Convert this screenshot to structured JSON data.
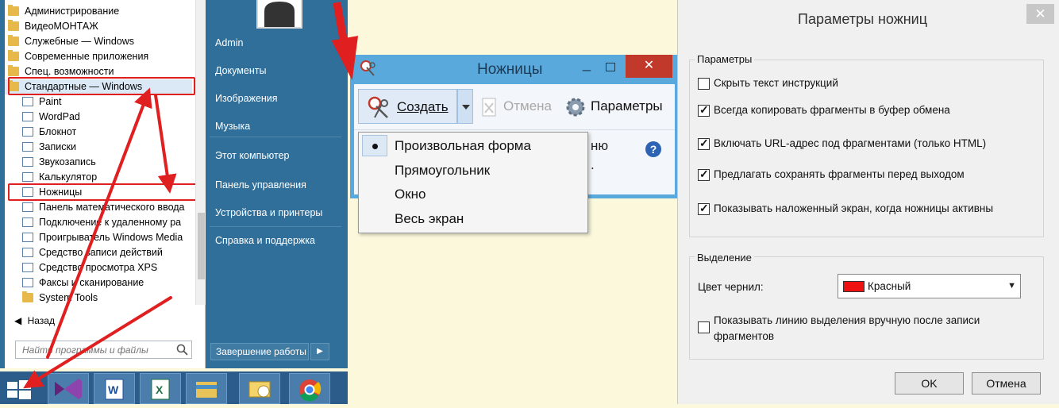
{
  "start_menu": {
    "programs": [
      {
        "label": "Администрирование",
        "icon": "folder-icon"
      },
      {
        "label": "ВидеоМОНТАЖ",
        "icon": "folder-icon"
      },
      {
        "label": "Служебные — Windows",
        "icon": "folder-icon"
      },
      {
        "label": "Современные приложения",
        "icon": "folder-icon"
      },
      {
        "label": "Спец. возможности",
        "icon": "folder-icon"
      },
      {
        "label": "Стандартные — Windows",
        "icon": "folder-icon"
      },
      {
        "label": "Paint",
        "icon": "paint-icon"
      },
      {
        "label": "WordPad",
        "icon": "wordpad-icon"
      },
      {
        "label": "Блокнот",
        "icon": "notepad-icon"
      },
      {
        "label": "Записки",
        "icon": "sticky-notes-icon"
      },
      {
        "label": "Звукозапись",
        "icon": "microphone-icon"
      },
      {
        "label": "Калькулятор",
        "icon": "calculator-icon"
      },
      {
        "label": "Ножницы",
        "icon": "scissors-icon"
      },
      {
        "label": "Панель математического ввода",
        "icon": "math-input-icon"
      },
      {
        "label": "Подключение к удаленному ра",
        "icon": "remote-desktop-icon"
      },
      {
        "label": "Проигрыватель Windows Media",
        "icon": "media-player-icon"
      },
      {
        "label": "Средство записи действий",
        "icon": "steps-recorder-icon"
      },
      {
        "label": "Средство просмотра XPS",
        "icon": "xps-viewer-icon"
      },
      {
        "label": "Факсы и сканирование",
        "icon": "fax-icon"
      },
      {
        "label": "System Tools",
        "icon": "folder-icon"
      }
    ],
    "back_label": "Назад",
    "search_placeholder": "Найти программы и файлы",
    "right_links": [
      "Admin",
      "Документы",
      "Изображения",
      "Музыка",
      "Этот компьютер",
      "Панель управления",
      "Устройства и принтеры",
      "Справка и поддержка"
    ],
    "shutdown_label": "Завершение работы"
  },
  "snipping_tool": {
    "title": "Ножницы",
    "close_glyph": "✕",
    "create_label": "Создать",
    "cancel_label": "Отмена",
    "options_label": "Параметры",
    "partial_text_1": "ню",
    "partial_text_2": ".",
    "help_glyph": "?",
    "mode_menu": [
      "Произвольная форма",
      "Прямоугольник",
      "Окно",
      "Весь экран"
    ],
    "selected_mode": "Произвольная форма"
  },
  "options_dialog": {
    "title": "Параметры ножниц",
    "close_glyph": "✕",
    "group_params": "Параметры",
    "options": [
      {
        "label": "Скрыть текст инструкций",
        "checked": false
      },
      {
        "label": "Всегда копировать фрагменты в буфер обмена",
        "checked": true
      },
      {
        "label": "Включать URL-адрес под фрагментами (только HTML)",
        "checked": true
      },
      {
        "label": "Предлагать сохранять фрагменты перед выходом",
        "checked": true
      },
      {
        "label": "Показывать наложенный экран, когда ножницы активны",
        "checked": true
      }
    ],
    "group_selection": "Выделение",
    "ink_label": "Цвет чернил:",
    "ink_value": "Красный",
    "ink_color": "#ee1111",
    "show_line_label_1": "Показывать линию выделения вручную после записи",
    "show_line_label_2": "фрагментов",
    "show_line_checked": false,
    "ok_label": "OK",
    "cancel_label": "Отмена"
  },
  "colors": {
    "annotation_red": "#e02020",
    "start_menu_blue": "#2f6f9a",
    "taskbar_blue": "#2b5c8a"
  }
}
